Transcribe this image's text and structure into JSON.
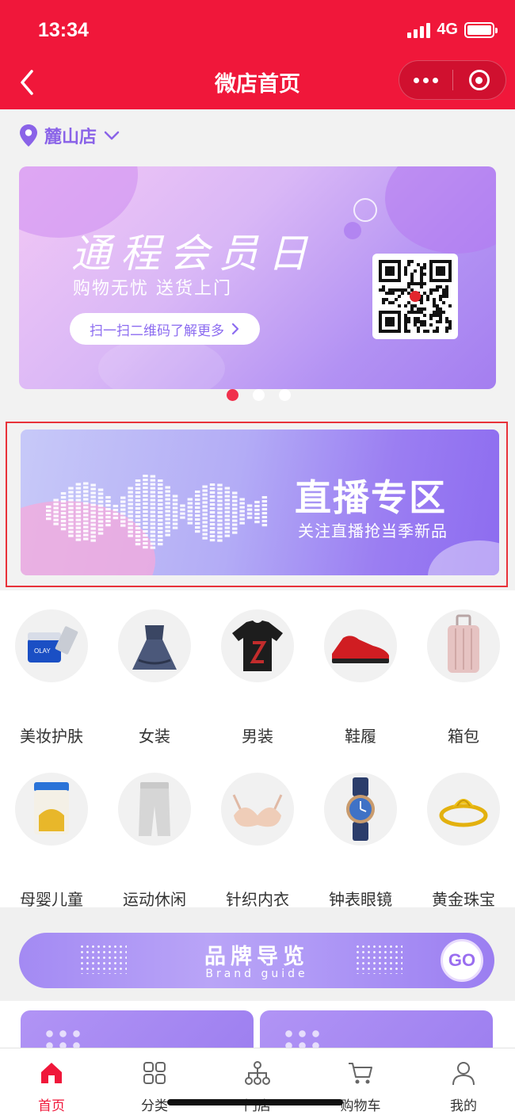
{
  "status_bar": {
    "time": "13:34",
    "network": "4G"
  },
  "nav": {
    "title": "微店首页"
  },
  "store": {
    "name": "麓山店"
  },
  "banner": {
    "title": "通程会员日",
    "subtitle": "购物无忧 送货上门",
    "button_label": "扫一扫二维码了解更多",
    "slides_total": 3,
    "active_slide": 1
  },
  "live_banner": {
    "title": "直播专区",
    "subtitle": "关注直播抢当季新品"
  },
  "categories": [
    {
      "label": "美妆护肤",
      "icon": "cosmetics-icon"
    },
    {
      "label": "女装",
      "icon": "dress-icon"
    },
    {
      "label": "男装",
      "icon": "tshirt-icon"
    },
    {
      "label": "鞋履",
      "icon": "sneaker-icon"
    },
    {
      "label": "箱包",
      "icon": "suitcase-icon"
    },
    {
      "label": "母婴儿童",
      "icon": "milk-powder-icon"
    },
    {
      "label": "运动休闲",
      "icon": "sweatpants-icon"
    },
    {
      "label": "针织内衣",
      "icon": "bra-icon"
    },
    {
      "label": "钟表眼镜",
      "icon": "watch-icon"
    },
    {
      "label": "黄金珠宝",
      "icon": "gold-ring-icon"
    }
  ],
  "brand_guide": {
    "title": "品牌导览",
    "subtitle": "Brand guide",
    "go_label": "GO"
  },
  "tabbar": [
    {
      "label": "首页",
      "icon": "home-icon",
      "active": true
    },
    {
      "label": "分类",
      "icon": "grid-icon",
      "active": false
    },
    {
      "label": "门店",
      "icon": "store-network-icon",
      "active": false
    },
    {
      "label": "购物车",
      "icon": "cart-icon",
      "active": false
    },
    {
      "label": "我的",
      "icon": "user-icon",
      "active": false
    }
  ],
  "colors": {
    "brand_red": "#f0173a",
    "accent_purple": "#8a63e8"
  }
}
